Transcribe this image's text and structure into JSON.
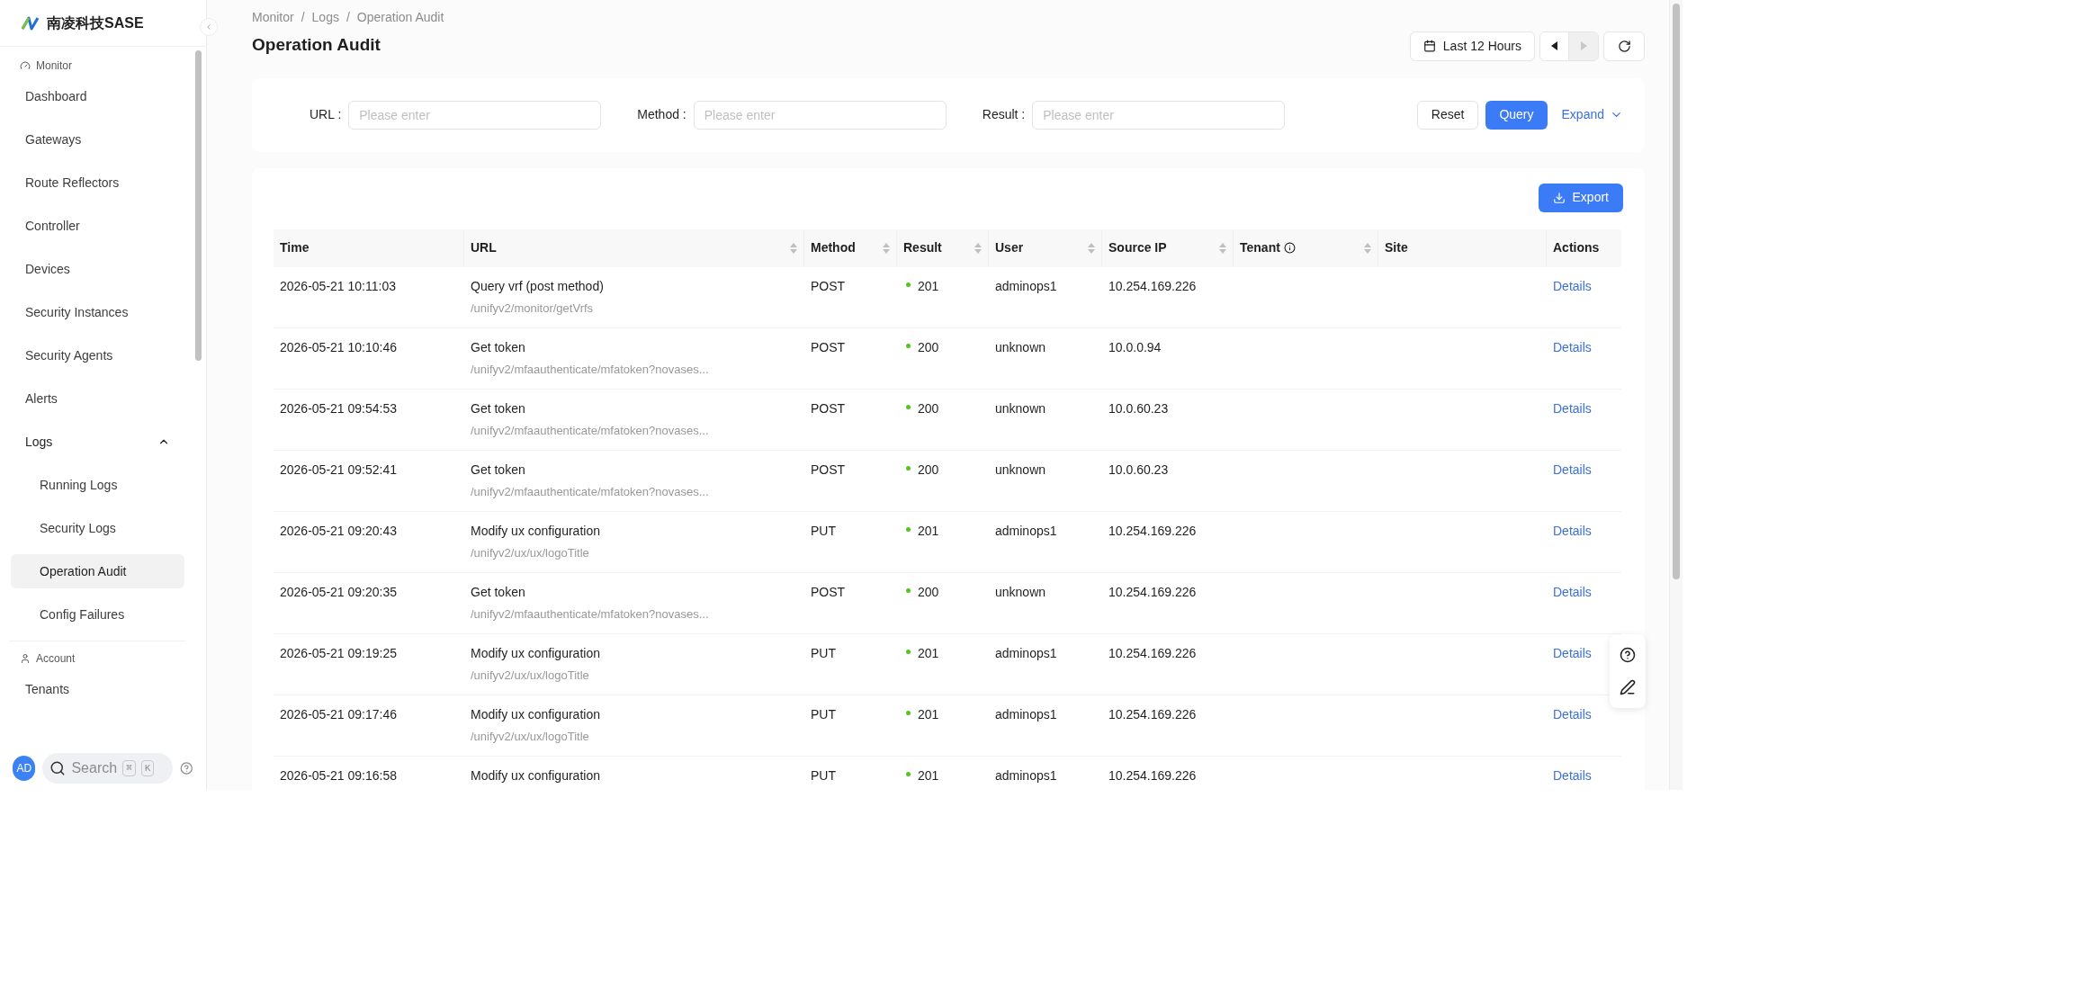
{
  "sidebar": {
    "logo_text": "南凌科技SASE",
    "groups": [
      {
        "title": "Monitor",
        "items": [
          {
            "label": "Dashboard",
            "selected": false
          },
          {
            "label": "Gateways",
            "selected": false
          },
          {
            "label": "Route Reflectors",
            "selected": false
          },
          {
            "label": "Controller",
            "selected": false
          },
          {
            "label": "Devices",
            "selected": false
          },
          {
            "label": "Security Instances",
            "selected": false
          },
          {
            "label": "Security Agents",
            "selected": false
          },
          {
            "label": "Alerts",
            "selected": false
          },
          {
            "label": "Logs",
            "selected": false,
            "expanded": true,
            "children": [
              {
                "label": "Running Logs",
                "selected": false
              },
              {
                "label": "Security Logs",
                "selected": false
              },
              {
                "label": "Operation Audit",
                "selected": true
              },
              {
                "label": "Config Failures",
                "selected": false
              }
            ]
          }
        ]
      },
      {
        "title": "Account",
        "items": [
          {
            "label": "Tenants",
            "selected": false
          }
        ]
      }
    ],
    "avatar": "AD",
    "search": {
      "placeholder": "Search",
      "keys": [
        "⌘",
        "K"
      ]
    }
  },
  "breadcrumb": {
    "items": [
      "Monitor",
      "Logs",
      "Operation Audit"
    ],
    "separator": "/"
  },
  "title": "Operation Audit",
  "time_range": {
    "label": "Last 12 Hours",
    "prev_disabled": false,
    "next_disabled": true
  },
  "filters": [
    {
      "label": "URL :",
      "placeholder": "Please enter"
    },
    {
      "label": "Method :",
      "placeholder": "Please enter"
    },
    {
      "label": "Result :",
      "placeholder": "Please enter"
    }
  ],
  "filter_buttons": {
    "reset": "Reset",
    "query": "Query",
    "expand": "Expand"
  },
  "export_button": "Export",
  "table": {
    "columns": [
      {
        "label": "Time",
        "sortable": false,
        "info": false
      },
      {
        "label": "URL",
        "sortable": true,
        "info": false
      },
      {
        "label": "Method",
        "sortable": true,
        "info": false
      },
      {
        "label": "Result",
        "sortable": true,
        "info": false
      },
      {
        "label": "User",
        "sortable": true,
        "info": false
      },
      {
        "label": "Source IP",
        "sortable": true,
        "info": false
      },
      {
        "label": "Tenant",
        "sortable": true,
        "info": true
      },
      {
        "label": "Site",
        "sortable": false,
        "info": false
      },
      {
        "label": "Actions",
        "sortable": false,
        "info": false
      }
    ],
    "rows": [
      {
        "time": "2026-05-21 10:11:03",
        "name": "Query vrf (post method)",
        "path": "/unifyv2/monitor/getVrfs",
        "method": "POST",
        "result": "201",
        "user": "adminops1",
        "source_ip": "10.254.169.226",
        "action": "Details"
      },
      {
        "time": "2026-05-21 10:10:46",
        "name": "Get token",
        "path": "/unifyv2/mfaauthenticate/mfatoken?novases...",
        "method": "POST",
        "result": "200",
        "user": "unknown",
        "source_ip": "10.0.0.94",
        "action": "Details"
      },
      {
        "time": "2026-05-21 09:54:53",
        "name": "Get token",
        "path": "/unifyv2/mfaauthenticate/mfatoken?novases...",
        "method": "POST",
        "result": "200",
        "user": "unknown",
        "source_ip": "10.0.60.23",
        "action": "Details"
      },
      {
        "time": "2026-05-21 09:52:41",
        "name": "Get token",
        "path": "/unifyv2/mfaauthenticate/mfatoken?novases...",
        "method": "POST",
        "result": "200",
        "user": "unknown",
        "source_ip": "10.0.60.23",
        "action": "Details"
      },
      {
        "time": "2026-05-21 09:20:43",
        "name": "Modify ux configuration",
        "path": "/unifyv2/ux/ux/logoTitle",
        "method": "PUT",
        "result": "201",
        "user": "adminops1",
        "source_ip": "10.254.169.226",
        "action": "Details"
      },
      {
        "time": "2026-05-21 09:20:35",
        "name": "Get token",
        "path": "/unifyv2/mfaauthenticate/mfatoken?novases...",
        "method": "POST",
        "result": "200",
        "user": "unknown",
        "source_ip": "10.254.169.226",
        "action": "Details"
      },
      {
        "time": "2026-05-21 09:19:25",
        "name": "Modify ux configuration",
        "path": "/unifyv2/ux/ux/logoTitle",
        "method": "PUT",
        "result": "201",
        "user": "adminops1",
        "source_ip": "10.254.169.226",
        "action": "Details"
      },
      {
        "time": "2026-05-21 09:17:46",
        "name": "Modify ux configuration",
        "path": "/unifyv2/ux/ux/logoTitle",
        "method": "PUT",
        "result": "201",
        "user": "adminops1",
        "source_ip": "10.254.169.226",
        "action": "Details"
      },
      {
        "time": "2026-05-21 09:16:58",
        "name": "Modify ux configuration",
        "method": "PUT",
        "result": "201",
        "user": "adminops1",
        "source_ip": "10.254.169.226",
        "action": "Details"
      }
    ]
  }
}
